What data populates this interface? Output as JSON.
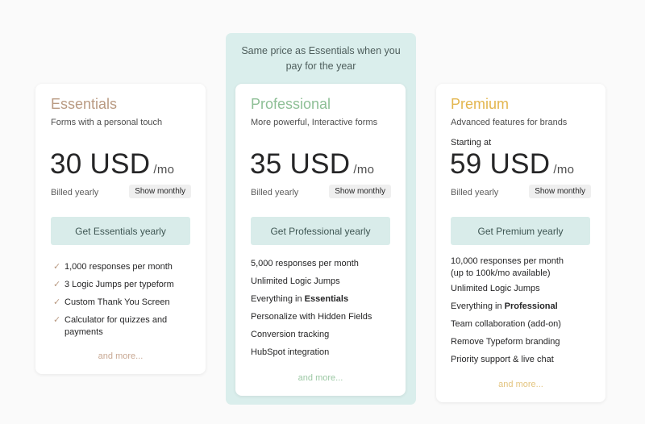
{
  "highlight_banner": "Same price as Essentials when you pay for the year",
  "plans": [
    {
      "name": "Essentials",
      "name_color": "#b99a82",
      "subtitle": "Forms with a personal touch",
      "starting_at": "",
      "price": "30 USD",
      "period": "/mo",
      "billed": "Billed yearly",
      "show_monthly": "Show monthly",
      "cta": "Get Essentials yearly",
      "features": [
        {
          "text": "1,000 responses per month"
        },
        {
          "text": "3 Logic Jumps per typeform"
        },
        {
          "text": "Custom Thank You Screen"
        },
        {
          "text": "Calculator for quizzes and payments"
        }
      ],
      "check_icon": "checkmark-icon",
      "and_more": "and more...",
      "and_more_color": "#c8a893"
    },
    {
      "name": "Professional",
      "name_color": "#8ebf96",
      "subtitle": "More powerful, Interactive forms",
      "starting_at": "",
      "price": "35 USD",
      "period": "/mo",
      "billed": "Billed yearly",
      "show_monthly": "Show monthly",
      "cta": "Get Professional yearly",
      "features": [
        {
          "text": "5,000 responses per month"
        },
        {
          "text": "Unlimited Logic Jumps"
        },
        {
          "text": "Everything in ",
          "bold": "Essentials"
        },
        {
          "text": "Personalize with Hidden Fields"
        },
        {
          "text": "Conversion tracking"
        },
        {
          "text": "HubSpot integration"
        }
      ],
      "and_more": "and more...",
      "and_more_color": "#9cc8a4"
    },
    {
      "name": "Premium",
      "name_color": "#e3b64f",
      "subtitle": "Advanced features for brands",
      "starting_at": "Starting at",
      "price": "59 USD",
      "period": "/mo",
      "billed": "Billed yearly",
      "show_monthly": "Show monthly",
      "cta": "Get Premium yearly",
      "features": [
        {
          "text": "10,000 responses per month (up to 100k/mo available)"
        },
        {
          "text": "Unlimited Logic Jumps"
        },
        {
          "text": "Everything in ",
          "bold": "Professional"
        },
        {
          "text": "Team collaboration (add-on)"
        },
        {
          "text": "Remove Typeform branding"
        },
        {
          "text": "Priority support & live chat"
        }
      ],
      "and_more": "and more...",
      "and_more_color": "#e3c47f"
    }
  ]
}
